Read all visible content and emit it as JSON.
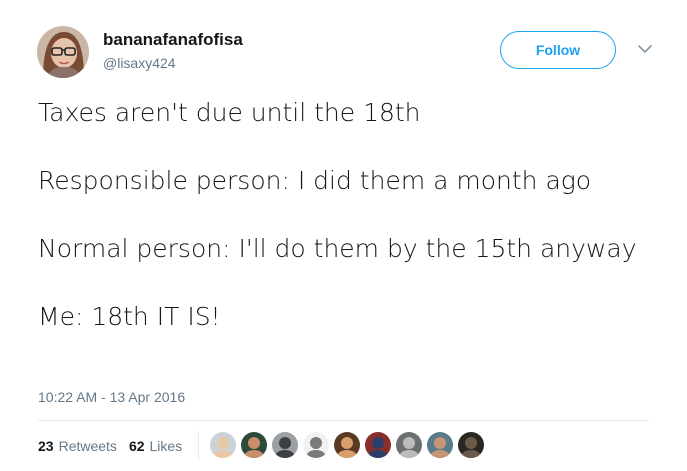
{
  "author": {
    "display_name": "bananafanafofisa",
    "handle": "@lisaxy424"
  },
  "follow_label": "Follow",
  "tweet": {
    "paragraphs": [
      "Taxes aren't due until the 18th",
      "Responsible person: I did them a month ago",
      "Normal person: I'll do them by the 15th anyway",
      "Me: 18th IT IS!"
    ],
    "timestamp": "10:22 AM - 13 Apr 2016"
  },
  "stats": {
    "retweets_count": "23",
    "retweets_label": "Retweets",
    "likes_count": "62",
    "likes_label": "Likes"
  },
  "colors": {
    "accent": "#1da1f2",
    "muted": "#657786",
    "text": "#14171a",
    "divider": "#e6ecf0"
  },
  "liker_avatars": [
    {
      "icon": "avatar-woman-blonde-icon",
      "bg": "#cbd3d8",
      "fg": "#e8c9a6"
    },
    {
      "icon": "avatar-woman-dark-icon",
      "bg": "#2c4a3a",
      "fg": "#c88f6a"
    },
    {
      "icon": "avatar-man-bw-icon",
      "bg": "#9aa0a4",
      "fg": "#3d3f42"
    },
    {
      "icon": "avatar-sketch-icon",
      "bg": "#f1f1f1",
      "fg": "#7a7a7a"
    },
    {
      "icon": "avatar-man-glasses-icon",
      "bg": "#5a3a24",
      "fg": "#d9a06b"
    },
    {
      "icon": "avatar-patterned-icon",
      "bg": "#8a2d2d",
      "fg": "#2c3e6a"
    },
    {
      "icon": "avatar-group-icon",
      "bg": "#6a7070",
      "fg": "#bcbcbc"
    },
    {
      "icon": "avatar-man-outdoors-icon",
      "bg": "#5a7a8a",
      "fg": "#c59673"
    },
    {
      "icon": "avatar-dark-icon",
      "bg": "#2a2622",
      "fg": "#6b5a4a"
    }
  ]
}
